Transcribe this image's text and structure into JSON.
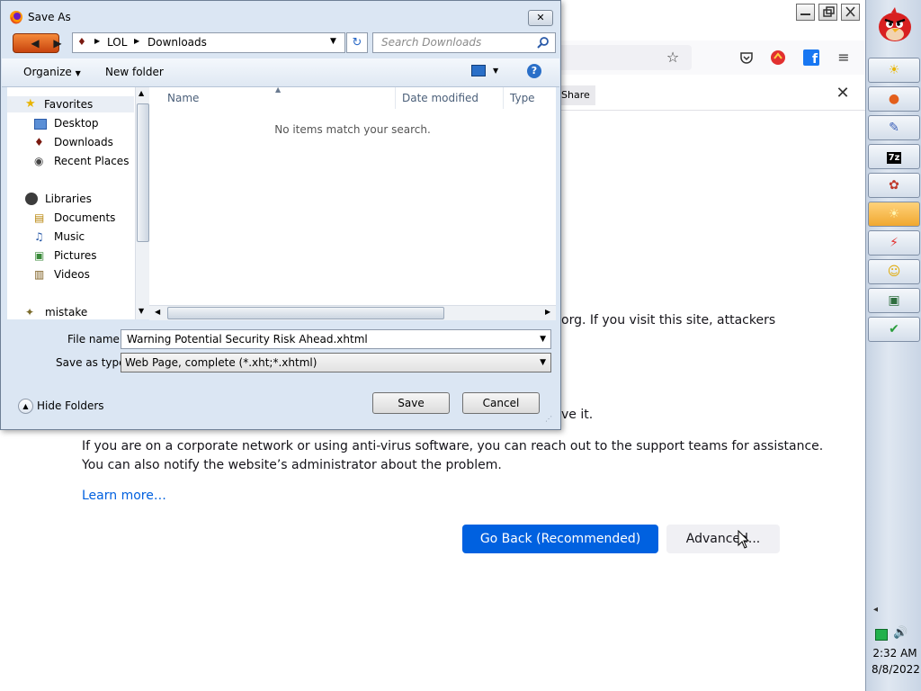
{
  "browser": {
    "share_label": "Share",
    "body_line1_tail": "org. If you visit this site, attackers",
    "body_line2_tail": "ve it.",
    "corporate_line1": "If you are on a corporate network or using anti-virus software, you can reach out to the support teams for assistance.",
    "corporate_line2": "You can also notify the website’s administrator about the problem.",
    "learn_more": "Learn more…",
    "go_back_label": "Go Back (Recommended)",
    "advanced_label": "Advanced..."
  },
  "dialog": {
    "title": "Save As",
    "path": [
      "LOL",
      "Downloads"
    ],
    "search_placeholder": "Search Downloads",
    "organize_label": "Organize",
    "new_folder_label": "New folder",
    "nav": {
      "favorites": "Favorites",
      "desktop": "Desktop",
      "downloads": "Downloads",
      "recent_places": "Recent Places",
      "libraries": "Libraries",
      "documents": "Documents",
      "music": "Music",
      "pictures": "Pictures",
      "videos": "Videos",
      "mistake": "mistake"
    },
    "columns": [
      "Name",
      "Date modified",
      "Type"
    ],
    "empty_message": "No items match your search.",
    "file_name_label": "File name:",
    "file_name_value": "Warning Potential Security Risk Ahead.xhtml",
    "save_type_label": "Save as type:",
    "save_type_value": "Web Page, complete (*.xht;*.xhtml)",
    "hide_folders_label": "Hide Folders",
    "save_label": "Save",
    "cancel_label": "Cancel"
  },
  "tray": {
    "time": "2:32 AM",
    "date": "8/8/2022"
  },
  "icons": {
    "dock": [
      "angry-bird-icon",
      "sun-app-icon",
      "firefox-icon",
      "vector-app-icon",
      "7zip-icon",
      "paint-app-icon",
      "sun-active-icon",
      "flash-icon",
      "smiley-icon",
      "monitor-icon",
      "shield-icon"
    ]
  }
}
